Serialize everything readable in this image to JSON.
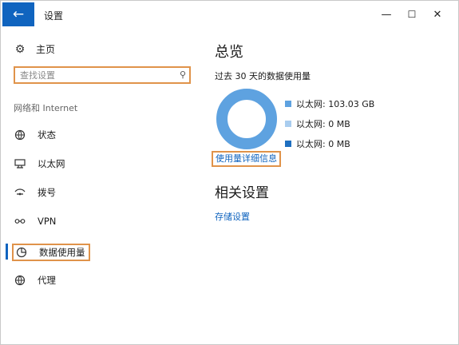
{
  "window": {
    "title": "设置",
    "back_icon": "arrow-left-icon",
    "controls": {
      "minimize": "—",
      "maximize": "☐",
      "close": "✕"
    }
  },
  "sidebar": {
    "home_label": "主页",
    "search_placeholder": "查找设置",
    "section_label": "网络和 Internet",
    "items": [
      {
        "label": "状态",
        "icon": "globe-status-icon"
      },
      {
        "label": "以太网",
        "icon": "ethernet-icon"
      },
      {
        "label": "拨号",
        "icon": "dialup-icon"
      },
      {
        "label": "VPN",
        "icon": "vpn-icon"
      },
      {
        "label": "数据使用量",
        "icon": "data-usage-icon",
        "selected": true
      },
      {
        "label": "代理",
        "icon": "proxy-icon"
      }
    ]
  },
  "main": {
    "title": "总览",
    "subtitle": "过去 30 天的数据使用量",
    "usage": [
      {
        "label": "以太网: 103.03 GB",
        "color": "#5ea2e0"
      },
      {
        "label": "以太网: 0 MB",
        "color": "#a9cdef"
      },
      {
        "label": "以太网: 0 MB",
        "color": "#1f6fc0"
      }
    ],
    "details_link": "使用量详细信息",
    "related_title": "相关设置",
    "storage_link": "存储设置"
  },
  "colors": {
    "accent": "#1064bf",
    "highlight_box": "#e0934a",
    "donut": "#5ea2e0"
  }
}
